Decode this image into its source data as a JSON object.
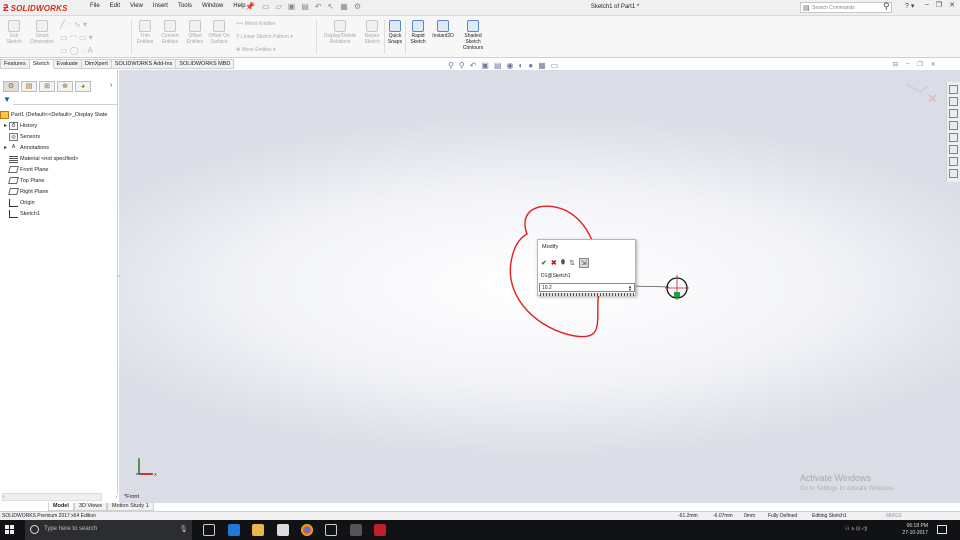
{
  "app": {
    "logo_text": "SOLIDWORKS",
    "document_title": "Sketch1 of Part1 *"
  },
  "menu": [
    "File",
    "Edit",
    "View",
    "Insert",
    "Tools",
    "Window",
    "Help"
  ],
  "search": {
    "placeholder": "Search Commands"
  },
  "help_label": "?",
  "ribbon": {
    "exit_sketch": "Exit Sketch",
    "smart_dimension": "Smart Dimension",
    "trim_entities": "Trim Entities",
    "convert_entities": "Convert Entities",
    "offset_entities": "Offset Entities",
    "offset_on_surface": "Offset On Surface",
    "mirror_entities": "Mirror Entities",
    "linear_sketch_pattern": "Linear Sketch Pattern",
    "move_entities": "Move Entities",
    "display_delete_relations": "Display/Delete Relations",
    "repair_sketch": "Repair Sketch",
    "quick_snaps": "Quick Snaps",
    "rapid_sketch": "Rapid Sketch",
    "instant2d": "Instant2D",
    "shaded_sketch_contours": "Shaded Sketch Contours"
  },
  "command_tabs": [
    {
      "label": "Features",
      "selected": false
    },
    {
      "label": "Sketch",
      "selected": true
    },
    {
      "label": "Evaluate",
      "selected": false
    },
    {
      "label": "DimXpert",
      "selected": false
    },
    {
      "label": "SOLIDWORKS Add-Ins",
      "selected": false
    },
    {
      "label": "SOLIDWORKS MBD",
      "selected": false
    }
  ],
  "feature_tree": {
    "root": "Part1  (Default<<Default>_Display State",
    "items": [
      {
        "label": "History",
        "expander": "▸",
        "icon": "history-icon"
      },
      {
        "label": "Sensors",
        "expander": "",
        "icon": "sensors-icon"
      },
      {
        "label": "Annotations",
        "expander": "▸",
        "icon": "annotations-icon"
      },
      {
        "label": "Material <not specified>",
        "expander": "",
        "icon": "material-icon"
      },
      {
        "label": "Front Plane",
        "expander": "",
        "icon": "plane-icon"
      },
      {
        "label": "Top Plane",
        "expander": "",
        "icon": "plane-icon"
      },
      {
        "label": "Right Plane",
        "expander": "",
        "icon": "plane-icon"
      },
      {
        "label": "Origin",
        "expander": "",
        "icon": "origin-icon"
      },
      {
        "label": "Sketch1",
        "expander": "",
        "icon": "sketch-icon"
      }
    ]
  },
  "modify_dialog": {
    "title": "Modify",
    "dimension_name": "D1@Sketch1",
    "value": "10.2"
  },
  "view_label": "*Front",
  "bottom_tabs": [
    {
      "label": "Model",
      "selected": true
    },
    {
      "label": "3D Views",
      "selected": false
    },
    {
      "label": "Motion Study 1",
      "selected": false
    }
  ],
  "status_bar": {
    "edition": "SOLIDWORKS Premium 2017 x64 Edition",
    "x": "-61.2mm",
    "y": "-6.07mm",
    "z": "0mm",
    "state": "Fully Defined",
    "editing": "Editing Sketch1",
    "units": "MMGS"
  },
  "watermark": {
    "line1": "Activate Windows",
    "line2": "Go to Settings to activate Windows."
  },
  "taskbar": {
    "search_placeholder": "Type here to search",
    "time": "06:18 PM",
    "date": "27-10-2017"
  },
  "colors": {
    "brand": "#d52b1e",
    "annotation": "#e02020",
    "ok": "#2e8b2e",
    "cancel": "#c02020"
  }
}
